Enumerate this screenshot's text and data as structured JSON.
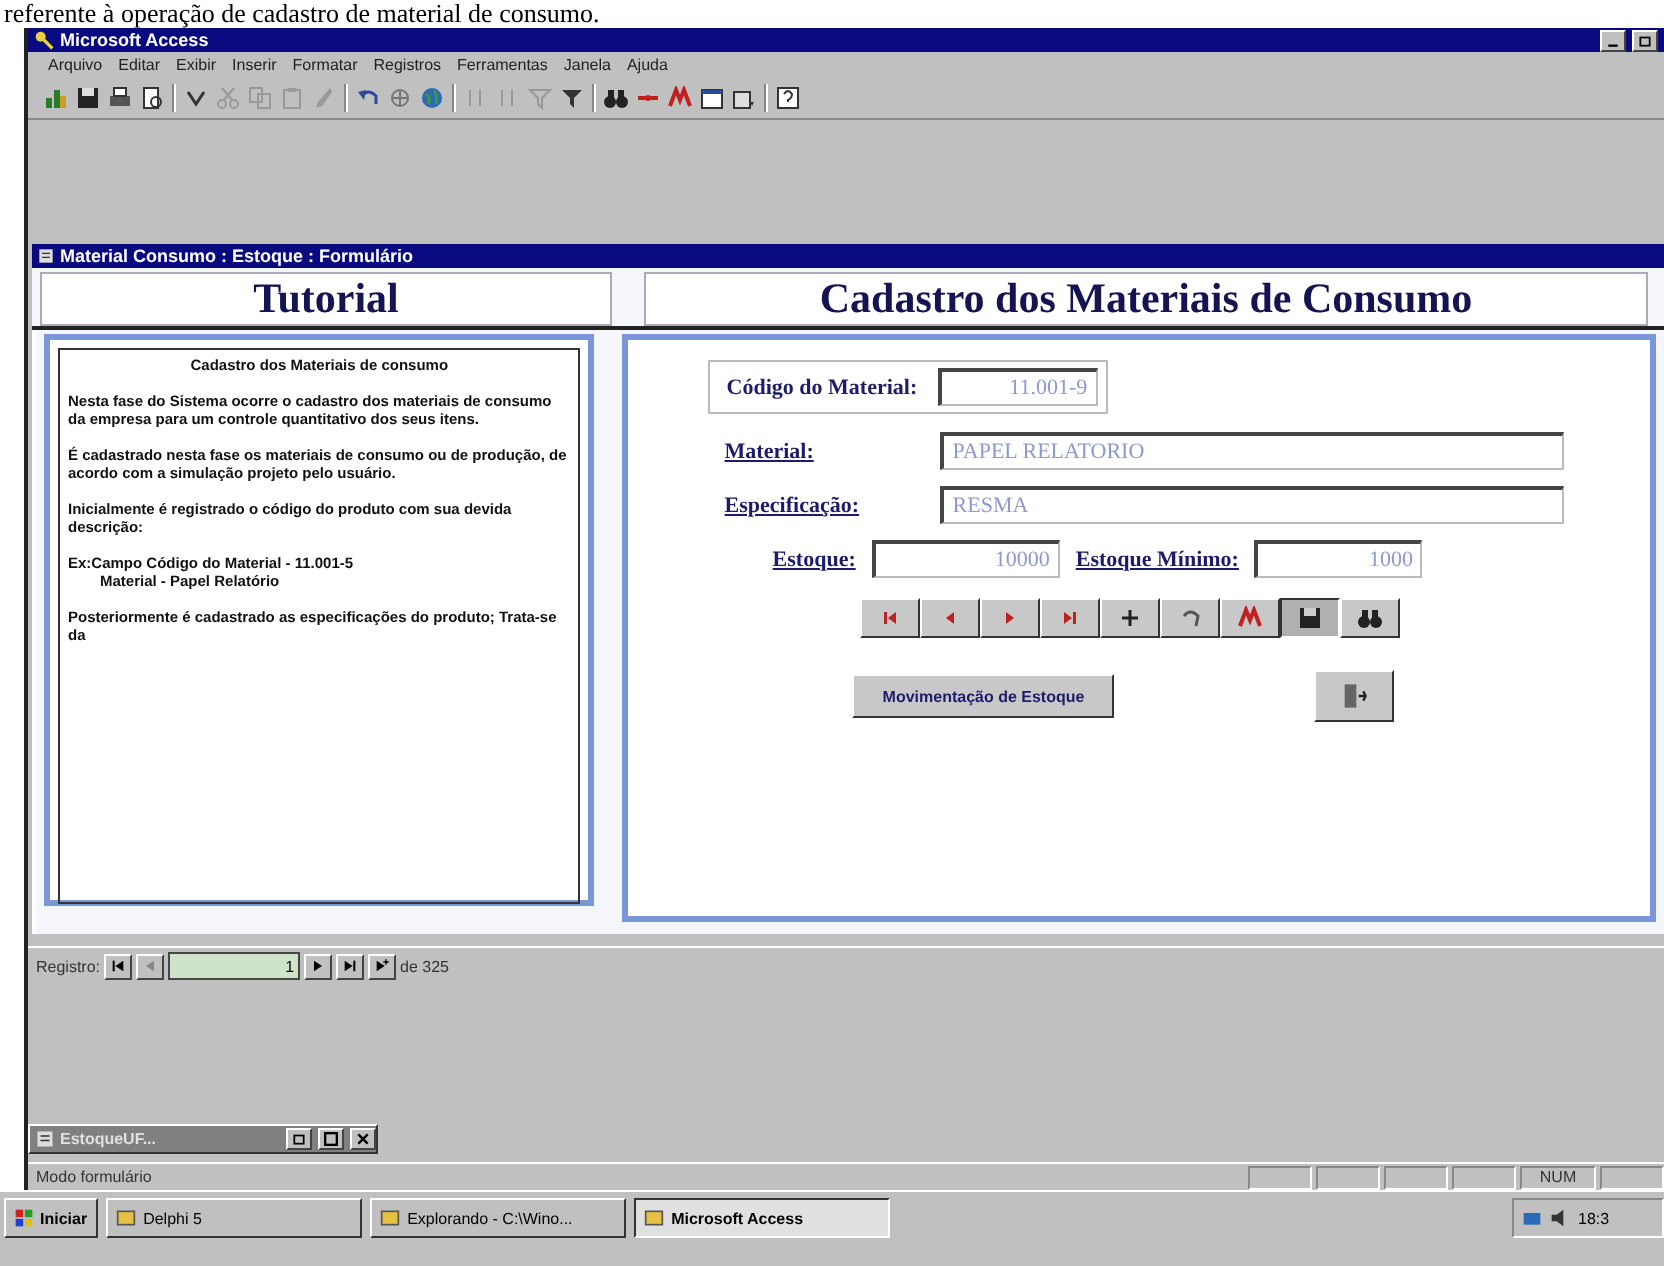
{
  "caption": "referente à operação de cadastro de material de consumo.",
  "window": {
    "title": "Microsoft Access"
  },
  "menu": [
    "Arquivo",
    "Editar",
    "Exibir",
    "Inserir",
    "Formatar",
    "Registros",
    "Ferramentas",
    "Janela",
    "Ajuda"
  ],
  "form": {
    "title": "Material Consumo : Estoque : Formulário",
    "tutorial": {
      "heading": "Tutorial",
      "paragraphs": [
        {
          "kind": "title",
          "text": "Cadastro dos Materiais de consumo"
        },
        {
          "kind": "text",
          "text": "Nesta fase do Sistema ocorre o cadastro dos materiais de consumo da empresa para um controle quantitativo dos seus itens."
        },
        {
          "kind": "text",
          "text": "É cadastrado nesta fase os materiais de consumo ou de produção, de acordo com a simulação projeto pelo usuário."
        },
        {
          "kind": "text",
          "text": "Inicialmente é registrado o código do produto com sua devida descrição:"
        },
        {
          "kind": "example",
          "text": "Ex:Campo Código do Material - 11.001-5",
          "sub": "Material - Papel Relatório"
        },
        {
          "kind": "text",
          "text": "Posteriormente é cadastrado as especificações do produto; Trata-se da"
        }
      ]
    },
    "heading": "Cadastro dos Materiais de Consumo",
    "code": {
      "label": "Código do Material:",
      "value": "11.001-9"
    },
    "material": {
      "label": "Material:",
      "value": "PAPEL RELATORIO"
    },
    "spec": {
      "label": "Especificação:",
      "value": "RESMA"
    },
    "stock": {
      "label": "Estoque:",
      "value": "10000"
    },
    "min_stock": {
      "label": "Estoque Mínimo:",
      "value": "1000"
    },
    "nav_buttons": [
      {
        "kind": "first",
        "pressed": false
      },
      {
        "kind": "prev",
        "pressed": false
      },
      {
        "kind": "next",
        "pressed": false
      },
      {
        "kind": "last",
        "pressed": false
      },
      {
        "kind": "new",
        "pressed": false
      },
      {
        "kind": "undo",
        "pressed": false
      },
      {
        "kind": "delete",
        "pressed": false
      },
      {
        "kind": "save",
        "pressed": true
      },
      {
        "kind": "find",
        "pressed": false
      }
    ],
    "move_button": "Movimentação de Estoque"
  },
  "record_nav": {
    "label": "Registro:",
    "current": "1",
    "total": "de 325"
  },
  "minimized": {
    "title": "EstoqueUF..."
  },
  "status": {
    "mode": "Modo formulário",
    "num": "NUM"
  },
  "taskbar": {
    "start": "Iniciar",
    "items": [
      {
        "label": "Delphi 5",
        "selected": false
      },
      {
        "label": "Explorando - C:\\Wino...",
        "selected": false
      },
      {
        "label": "Microsoft Access",
        "selected": true
      }
    ],
    "clock": "18:3"
  }
}
